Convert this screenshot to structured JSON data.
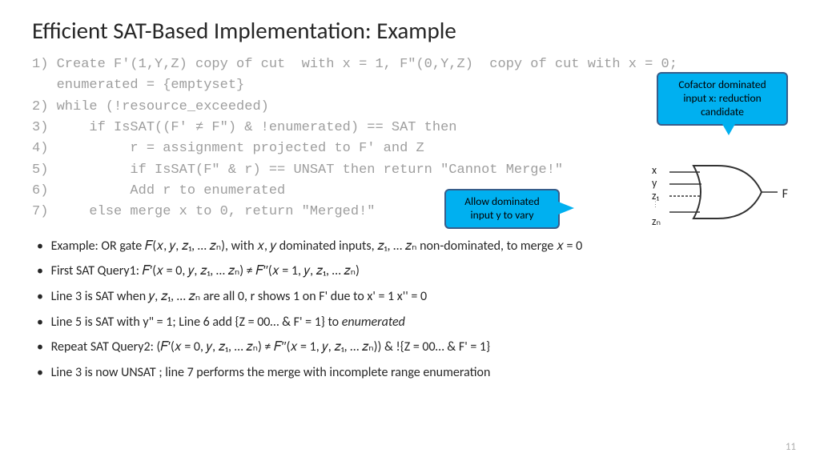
{
  "title": "Efficient SAT-Based Implementation: Example",
  "code": {
    "l1": "1) Create F'(1,Y,Z) copy of cut  with x = 1, F\"(0,Y,Z)  copy of cut with x = 0;",
    "l1b": "   enumerated = {emptyset}",
    "l2": "2) while (!resource_exceeded)",
    "l3": "3)     if IsSAT((F' ≠ F\") & !enumerated) == SAT then",
    "l4": "4)          r = assignment projected to F' and Z",
    "l5": "5)          if IsSAT(F\" & r) == UNSAT then return \"Cannot Merge!\"",
    "l6": "6)          Add r to enumerated",
    "l7": "7)     else merge x to 0, return \"Merged!\""
  },
  "bullets": {
    "b1": "Example: OR gate 𝐹(𝑥, 𝑦, 𝑧₁, … 𝑧ₙ), with 𝑥, 𝑦 dominated inputs, 𝑧₁, … 𝑧ₙ non-dominated, to merge 𝑥 = 0",
    "b2": "First SAT Query1: 𝐹′(𝑥 = 0, 𝑦, 𝑧₁, … 𝑧ₙ) ≠ 𝐹′′(𝑥 = 1, 𝑦, 𝑧₁, … 𝑧ₙ)",
    "b3": "Line 3 is SAT when  𝑦, 𝑧₁, … 𝑧ₙ are all 0, r shows 1 on F' due to x' = 1 x'' = 0",
    "b4_prefix": "Line 5 is SAT with y\" = 1; Line 6 add {Z = 00… & F' = 1} to ",
    "b4_em": "enumerated",
    "b5": "Repeat SAT Query2: (𝐹′(𝑥 = 0, 𝑦, 𝑧₁, … 𝑧ₙ) ≠ 𝐹′′(𝑥 = 1, 𝑦, 𝑧₁, … 𝑧ₙ)) & !{Z = 00… & F' = 1}",
    "b6": "Line 3 is now UNSAT ; line 7 performs the merge with incomplete range enumeration"
  },
  "callouts": {
    "c1": "Cofactor dominated input x: reduction candidate",
    "c2": "Allow dominated input y to vary"
  },
  "gate": {
    "in1": "x",
    "in2": "y",
    "in3": "z₁",
    "in4": "zₙ",
    "out": "F"
  },
  "pagenum": "11"
}
